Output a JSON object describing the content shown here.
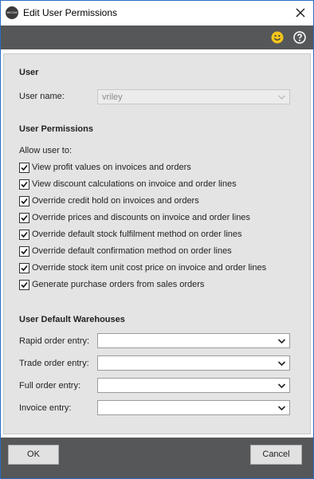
{
  "window": {
    "title": "Edit User Permissions",
    "app_icon_text": "WCOM"
  },
  "toolbar": {
    "feedback_icon": "smiley-icon",
    "help_icon": "help-icon"
  },
  "user": {
    "section_title": "User",
    "username_label": "User name:",
    "username_value": "vriley"
  },
  "permissions": {
    "section_title": "User Permissions",
    "intro": "Allow user to:",
    "items": [
      {
        "label": "View profit values on invoices and orders",
        "checked": true
      },
      {
        "label": "View discount calculations on invoice and order lines",
        "checked": true
      },
      {
        "label": "Override credit hold on invoices and orders",
        "checked": true
      },
      {
        "label": "Override prices and discounts on invoice and order lines",
        "checked": true
      },
      {
        "label": "Override default stock fulfilment method on order lines",
        "checked": true
      },
      {
        "label": "Override default confirmation method on order lines",
        "checked": true
      },
      {
        "label": "Override stock item unit cost price on invoice and order lines",
        "checked": true
      },
      {
        "label": "Generate purchase orders from sales orders",
        "checked": true
      }
    ]
  },
  "warehouses": {
    "section_title": "User Default Warehouses",
    "fields": [
      {
        "label": "Rapid order entry:",
        "value": ""
      },
      {
        "label": "Trade order entry:",
        "value": ""
      },
      {
        "label": "Full order entry:",
        "value": ""
      },
      {
        "label": "Invoice entry:",
        "value": ""
      }
    ]
  },
  "footer": {
    "ok_label": "OK",
    "cancel_label": "Cancel"
  },
  "colors": {
    "accent_dark": "#555759",
    "smiley": "#f2c51c",
    "window_border": "#2b6cc4"
  }
}
